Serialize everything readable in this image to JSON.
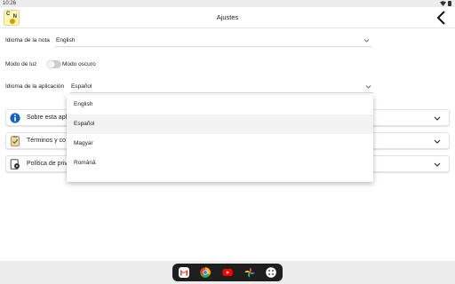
{
  "status_bar": {
    "time": "10:26"
  },
  "header": {
    "title": "Ajustes"
  },
  "app_logo": {
    "text_top": "C",
    "text_side": "N"
  },
  "settings": {
    "note_language": {
      "label": "Idioma de la nota",
      "value": "English"
    },
    "light_mode": {
      "label": "Modo de luz",
      "state_label": "Modo oscuro"
    },
    "app_language": {
      "label": "Idioma de la aplicación",
      "value": "Español"
    }
  },
  "sections": [
    {
      "label": "Sobre esta apl",
      "icon": "info-icon"
    },
    {
      "label": "Términos y co",
      "icon": "terms-document-icon"
    },
    {
      "label": "Política de priv",
      "icon": "privacy-policy-icon"
    }
  ],
  "language_options": {
    "items": [
      "English",
      "Español",
      "Magyar",
      "Română"
    ],
    "selected": "Español"
  },
  "taskbar_apps": [
    "gmail-icon",
    "chrome-icon",
    "youtube-icon",
    "photos-icon",
    "app-drawer-icon"
  ],
  "colors": {
    "info_blue": "#1565c0",
    "gmail_red": "#ea4335",
    "youtube_red": "#ff0000",
    "chrome_green": "#34a853",
    "taskbar_bg": "#1e1e1e"
  }
}
